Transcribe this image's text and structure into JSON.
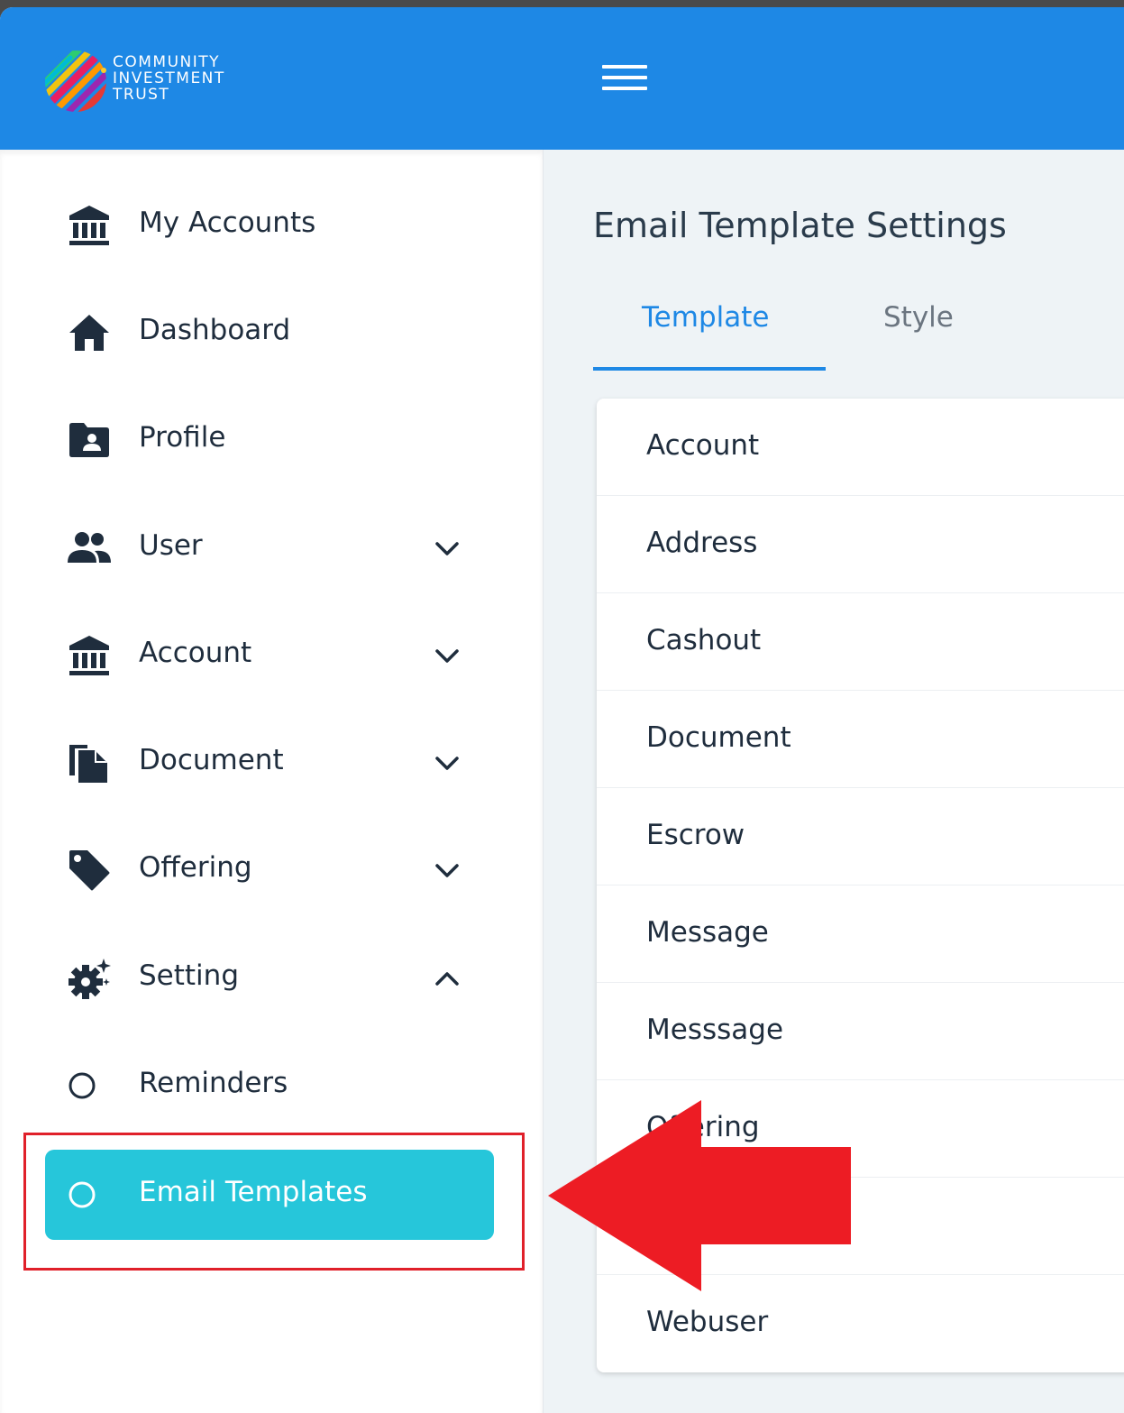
{
  "brand": {
    "line1": "COMMUNITY",
    "line2": "INVESTMENT",
    "line3": "TRUST",
    "color": "#1e88e5"
  },
  "topbar": {
    "menu_icon": "hamburger-menu-icon"
  },
  "sidebar": {
    "items": [
      {
        "label": "My Accounts",
        "icon": "bank-icon"
      },
      {
        "label": "Dashboard",
        "icon": "home-icon"
      },
      {
        "label": "Profile",
        "icon": "profile-folder-icon"
      },
      {
        "label": "User",
        "icon": "people-icon",
        "expandable": true,
        "expanded": false
      },
      {
        "label": "Account",
        "icon": "bank-icon",
        "expandable": true,
        "expanded": false
      },
      {
        "label": "Document",
        "icon": "documents-icon",
        "expandable": true,
        "expanded": false
      },
      {
        "label": "Offering",
        "icon": "tag-icon",
        "expandable": true,
        "expanded": false
      },
      {
        "label": "Setting",
        "icon": "gear-sparkle-icon",
        "expandable": true,
        "expanded": true
      },
      {
        "label": "Reminders",
        "icon": "circle-icon"
      },
      {
        "label": "Email Templates",
        "icon": "circle-icon",
        "active": true,
        "active_color": "#26c6da"
      }
    ]
  },
  "main": {
    "title": "Email Template Settings",
    "tabs": [
      {
        "label": "Template",
        "active": true
      },
      {
        "label": "Style",
        "active": false
      }
    ],
    "list": [
      "Account",
      "Address",
      "Cashout",
      "Document",
      "Escrow",
      "Message",
      "Messsage",
      "Offering",
      "",
      "Webuser"
    ]
  },
  "annotation": {
    "color": "#ed1c24"
  }
}
